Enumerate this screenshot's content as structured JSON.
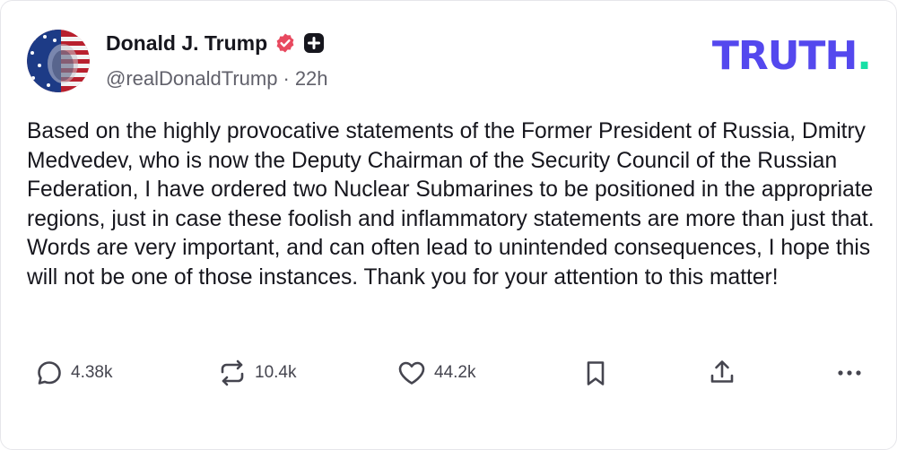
{
  "post": {
    "display_name": "Donald J. Trump",
    "handle": "@realDonaldTrump",
    "separator": "·",
    "time": "22h",
    "body": "Based on the highly provocative statements of the Former President of Russia, Dmitry Medvedev, who is now the Deputy Chairman of the Security Council of the Russian Federation, I have ordered two Nuclear Submarines to be positioned in the appropriate regions, just in case these foolish and inflammatory statements are more than just that. Words are very important, and can often lead to unintended consequences, I hope this will not be one of those instances. Thank you for your attention to this matter!"
  },
  "brand": {
    "logo_text": "TRUTH",
    "logo_dot": ".",
    "logo_color": "#5448ee",
    "dot_color": "#17e0a6"
  },
  "icons": {
    "verified": "verified-badge-icon",
    "plus": "plus-badge-icon",
    "reply": "reply-icon",
    "retruth": "retruth-icon",
    "like": "heart-icon",
    "bookmark": "bookmark-icon",
    "share": "share-icon",
    "more": "more-icon"
  },
  "actions": {
    "replies": "4.38k",
    "retruths": "10.4k",
    "likes": "44.2k"
  },
  "colors": {
    "verified_badge": "#e8495f",
    "text": "#16161d",
    "muted": "#61616b"
  }
}
